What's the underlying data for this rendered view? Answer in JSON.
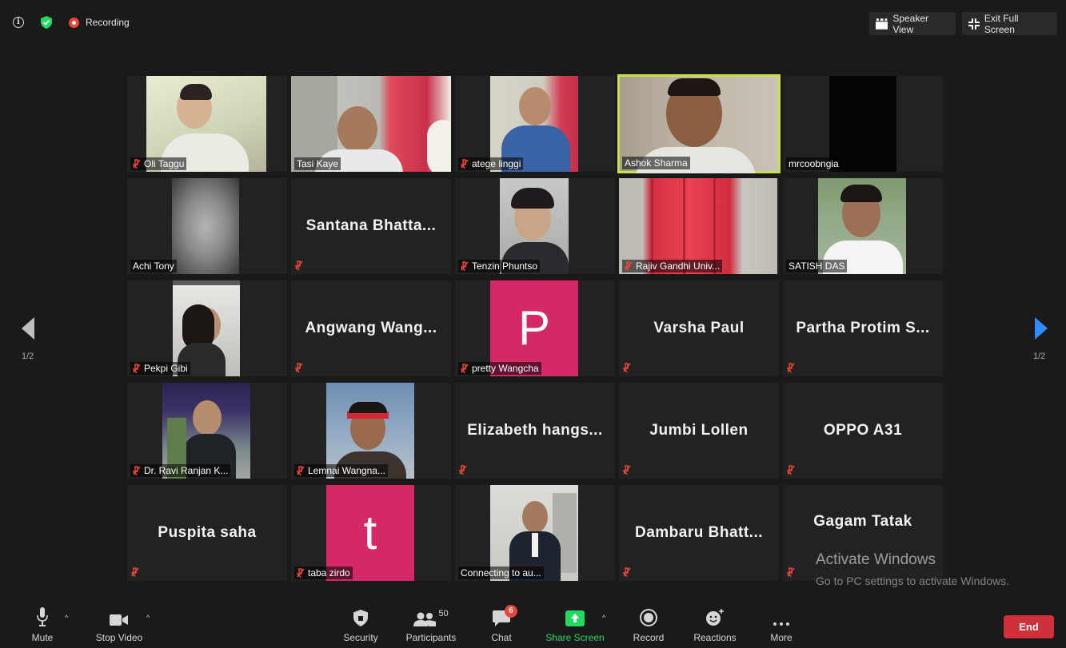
{
  "top_bar": {
    "recording_label": "Recording",
    "speaker_view_label": "Speaker View",
    "exit_fullscreen_label": "Exit Full Screen"
  },
  "tiles": [
    {
      "name": "Oli Taggu",
      "muted": true,
      "kind": "video"
    },
    {
      "name": "Tasi Kaye",
      "muted": false,
      "kind": "video"
    },
    {
      "name": "atege linggi",
      "muted": true,
      "kind": "video"
    },
    {
      "name": "Ashok Sharma",
      "muted": false,
      "kind": "video",
      "active_speaker": true
    },
    {
      "name": "mrcoobngia",
      "muted": false,
      "kind": "video"
    },
    {
      "name": "Achi Tony",
      "muted": false,
      "kind": "video"
    },
    {
      "name": "Santana  Bhatta...",
      "muted": true,
      "kind": "name-only"
    },
    {
      "name": "Tenzin Phuntso",
      "muted": true,
      "kind": "video"
    },
    {
      "name": "Rajiv Gandhi Univ...",
      "muted": true,
      "kind": "video"
    },
    {
      "name": "SATISH DAS",
      "muted": false,
      "kind": "video"
    },
    {
      "name": "Pekpi Gibi",
      "muted": true,
      "kind": "video"
    },
    {
      "name": "Angwang  Wang...",
      "muted": true,
      "kind": "name-only"
    },
    {
      "name": "pretty Wangcha",
      "muted": true,
      "kind": "avatar",
      "initial": "P"
    },
    {
      "name": "Varsha Paul",
      "muted": true,
      "kind": "name-only"
    },
    {
      "name": "Partha  Protim  S...",
      "muted": true,
      "kind": "name-only"
    },
    {
      "name": "Dr. Ravi Ranjan K...",
      "muted": true,
      "kind": "video"
    },
    {
      "name": "Lemnai Wangna...",
      "muted": true,
      "kind": "video"
    },
    {
      "name": "Elizabeth  hangs...",
      "muted": true,
      "kind": "name-only"
    },
    {
      "name": "Jumbi Lollen",
      "muted": true,
      "kind": "name-only"
    },
    {
      "name": "OPPO A31",
      "muted": true,
      "kind": "name-only"
    },
    {
      "name": "Puspita saha",
      "muted": true,
      "kind": "name-only"
    },
    {
      "name": "taba zirdo",
      "muted": true,
      "kind": "avatar",
      "initial": "t"
    },
    {
      "name": "Connecting to au...",
      "muted": false,
      "kind": "video"
    },
    {
      "name": "Dambaru  Bhatt...",
      "muted": true,
      "kind": "name-only"
    },
    {
      "name": "Gagam Tatak",
      "muted": true,
      "kind": "name-only"
    }
  ],
  "pagination": {
    "left": "1/2",
    "right": "1/2"
  },
  "watermark": {
    "title": "Activate Windows",
    "subtitle": "Go to PC settings to activate Windows."
  },
  "toolbar": {
    "mute": "Mute",
    "stop_video": "Stop Video",
    "security": "Security",
    "participants": "Participants",
    "participants_count": "50",
    "chat": "Chat",
    "chat_badge": "6",
    "share_screen": "Share Screen",
    "record": "Record",
    "reactions": "Reactions",
    "more": "More",
    "end": "End"
  },
  "colors": {
    "background": "#1a1a1a",
    "tile": "#222222",
    "active_speaker_border": "#c8e14d",
    "avatar": "#d42868",
    "share_green": "#23d95e",
    "end_red": "#d0303a"
  }
}
